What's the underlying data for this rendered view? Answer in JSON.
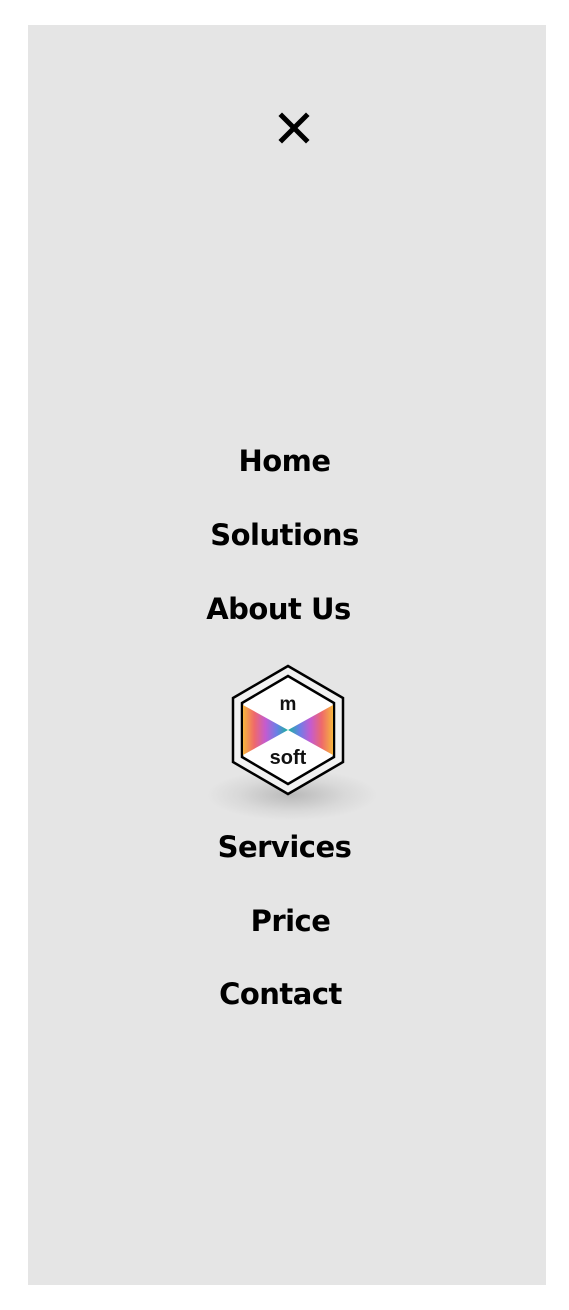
{
  "menu": {
    "close_icon": "close-icon",
    "items": [
      {
        "label": "Home"
      },
      {
        "label": "Solutions"
      },
      {
        "label": "About Us"
      },
      {
        "label": "Services"
      },
      {
        "label": "Price"
      },
      {
        "label": "Contact"
      }
    ]
  },
  "logo": {
    "top_text": "m",
    "bottom_text": "soft"
  },
  "colors": {
    "panel_background": "#e5e5e5",
    "text": "#000000"
  }
}
